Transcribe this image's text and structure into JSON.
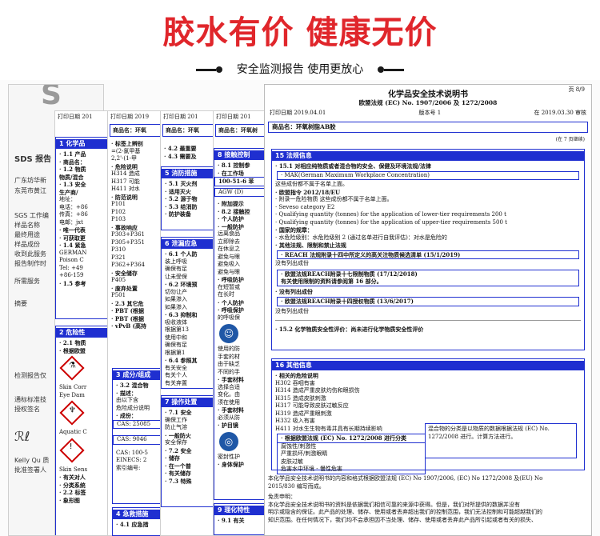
{
  "headline": "胶水有价 健康无价",
  "subline": "安全监测报告 使用更放心",
  "front": {
    "page": "页 8/9",
    "title": "化学品安全技术说明书",
    "subtitle": "欧盟法规 (EC) No. 1907/2006 及 1272/2008",
    "print_date": "打印日期 2019.04.01",
    "version": "版本号 1",
    "review": "在 2019.03.30 审核",
    "product": "商品名：环氧树脂AB胶",
    "continued": "(在 7 页继续)",
    "s15_title": "15 法规信息",
    "s15_lines": [
      "· 15.1 对相应纯物质或者混合物的安全、保健及环境法规/法律",
      "· MAK(German Maximum Workplace Concentration)",
      "  这些成份都不属于名单上面。",
      "· 欧盟指令 2012/18/EU",
      "· 附录一危险物质 这些成份都不属于名单上面。",
      "· Seveso category E2",
      "· Qualifying quantity (tonnes) for the application of lower-tier requirements 200 t",
      "· Qualifying quantity (tonnes) for the application of upper-tier requirements 500 t",
      "· 国家的规章：",
      "· 水危险级别：水危险级别 2 (通过名单进行自我评估)：对水是危险的",
      "· 其他法规、限制和禁止法规",
      "· REACH 法规附录十四中所定义的高关注物质候选清单 (15/1/2019)",
      "  没有列出成份",
      "· 欧盟法规REACH附录十七限制物质 (17/12/2018)",
      "  有关使用限制的资料请参阅第 16 部分。",
      "· 没有列出成份",
      "· 欧盟法规REACH附录十四授权物质 (13/6/2017)",
      "  没有列出成份",
      "· 15.2 化学物质安全性评价：尚未进行化学物质安全性评价"
    ],
    "s16_title": "16 其他信息",
    "s16_lines": [
      "· 相关的危险说明",
      "  H302 吞咽有害",
      "  H314 造成严重皮肤灼伤和眼损伤",
      "  H315 造成皮肤刺激",
      "  H317 可能导致皮肤过敏反应",
      "  H319 造成严重眼刺激",
      "  H332 吸入有害",
      "  H411 对水生生物有毒并具有长期持续影响",
      "· 根据欧盟法规 (EC) No. 1272/2008 进行分类"
    ],
    "s16_table_left": [
      "腐蚀性/刺激性",
      "严重损坏/刺激眼睛",
      "皮肤过敏",
      "危害水中环境 - 慢性危害"
    ],
    "s16_table_right": "混合物的分类是以物质的数据根据法规 (EC) No. 1272/2008 进行。计算方法进行。",
    "footer": [
      "本化学品安全技术说明书的内容和格式根据欧盟法规 (EC) No 1907/2006, (EC) No 1272/2008 及(EU) No",
      "2015/830 编写而成。",
      "免责申明：",
      "本化学品安全技术说明书的资料是依据我们相信可靠的来源中获得。但是，我们对所提供的数据并没有",
      "明示或隐含的保证。此产品的处理、储存、使用或者丢弃超出我们的控制范围，我们无法控制和可能超越我们的",
      "知识范围。在任何情况下，我们均不会承担因不当处理、储存、使用或者丢弃此产品所引起或者有关的损失、"
    ]
  },
  "sheets": {
    "print_label": "打印日期 201",
    "print_label2": "打印日期 2019",
    "product_short": "商品名：环氧",
    "product_short2": "商品名：环氧树",
    "s1": "1 化学品",
    "s2": "2 危险性",
    "s3": "3 成分/组成",
    "s4": "4 急救措施",
    "s5": "5 消防措施",
    "s6": "6 泄漏应急",
    "s7": "7 操作处置",
    "s8": "8 接触控制",
    "s9": "9 理化特性",
    "s1_lines": [
      "· 1.1 产品",
      "· 商品名：",
      "· 1.2 物质",
      "  物质/混合",
      "· 1.3 安全",
      "  生产商/",
      "  地址：",
      "  电话：+86",
      "  传真：+86",
      "  电邮：jxt",
      "· 唯一代表",
      "· 可获取更",
      "· 1.4 紧急",
      "  GERMAN",
      "  Poison C",
      "  Tel: +49",
      "  +86-159",
      "· 1.5 参考"
    ],
    "s2_lines": [
      "· 2.1 物质",
      "· 根据欧盟"
    ],
    "s2_icons": [
      "Skin Corr",
      "Eye Dam",
      "Aquatic C",
      "Skin Sens"
    ],
    "s2_tail": [
      "· 有关对人",
      "· 分类系统",
      "· 2.2 标签",
      "· 象形图"
    ],
    "mid1_lines": [
      "· 标签上辨别",
      "  =(2-氯甲基",
      "  2,2'-(1-甲",
      "· 危险说明",
      "  H314 造成",
      "  H317 可能",
      "  H411 对水",
      "· 防范说明",
      "  P101",
      "  P102",
      "  P103",
      "· 事故响应",
      "  P303+P361",
      "  P305+P351",
      "",
      "  P310",
      "  P321",
      "  P362+P364",
      "· 安全储存",
      "  P405",
      "· 废弃处置",
      "  P501",
      "· 2.3 其它危",
      "· PBT (根据",
      "· PBT (根据",
      "· vPvB (高持"
    ],
    "s3_lines": [
      "· 3.2 混合物",
      "· 描述：",
      "  由以下含",
      "  危险成分说明",
      "· 成份：",
      "  CAS: 25085",
      "  CAS: 9046",
      "  CAS: 100-5",
      "  EINECS: 2",
      "  索引编号:"
    ],
    "s4_lines": [
      "· 4.1 应急措"
    ],
    "mid2_lines": [
      "· 4.2 最重要",
      "· 4.3 需要及"
    ],
    "s5_lines": [
      "· 5.1 灭火剂",
      "· 适用灭火",
      "· 5.2 源于物",
      "· 5.3 给消防",
      "· 防护装备"
    ],
    "s6_lines": [
      "· 6.1 个人防",
      "  装上呼吸",
      "  确保有足",
      "  让未受保",
      "· 6.2 环境预",
      "  切勿让产",
      "  如果渗入",
      "  如果渗入",
      "· 6.3 抑制和",
      "  吸收液体",
      "  根据第13",
      "  使用中和",
      "  确保有足",
      "  根据第1",
      "· 6.4 参照其",
      "  有关安全",
      "  有关个人",
      "  有关弃置"
    ],
    "s7_lines": [
      "· 7.1 安全",
      "  确保工作",
      "  防止气溶",
      "· 一般防火",
      "  安全保存",
      "· 7.2 安全",
      "· 储存",
      "· 在一个普",
      "· 有关储存",
      "· 7.3 特殊"
    ],
    "s8_lines": [
      "· 8.1 控制参",
      "· 在工作场",
      "  100-51-6 苯",
      "  AGW (D)",
      "",
      "· 附加提示",
      "· 8.2 接触控",
      "· 个人防护",
      "· 一般防护",
      "  远离食品",
      "  立即除去",
      "  在休息之",
      "  避免与眼",
      "  避免吸入",
      "  避免与眼",
      "· 呼吸防护",
      "  在短暂或",
      "  在长时",
      "· 个人防护",
      "· 呼吸保护",
      "  的呼吸保",
      "  使用的防",
      "  手套的材",
      "  由于缺乏",
      "  不同的手",
      "· 手套材料",
      "  选择合适",
      "  变化。由",
      "  须在使用",
      "· 手套材料",
      "  必须从防",
      "· 护目镜",
      "  密封性护",
      "· 身体保护"
    ],
    "s9_lines": [
      "· 9.1 有关"
    ],
    "left_labels": [
      "SDS 报告",
      "广东坊华新",
      "东莞市黄江",
      "SGS 工作编",
      "样品名称",
      "最终用途",
      "样品成份",
      "收到此服务",
      "报告制作时",
      "所需服务",
      "摘要",
      "检测报告仅",
      "通标标准技",
      "授权签名",
      "Kelly Qu 质",
      "批准签署人"
    ]
  }
}
